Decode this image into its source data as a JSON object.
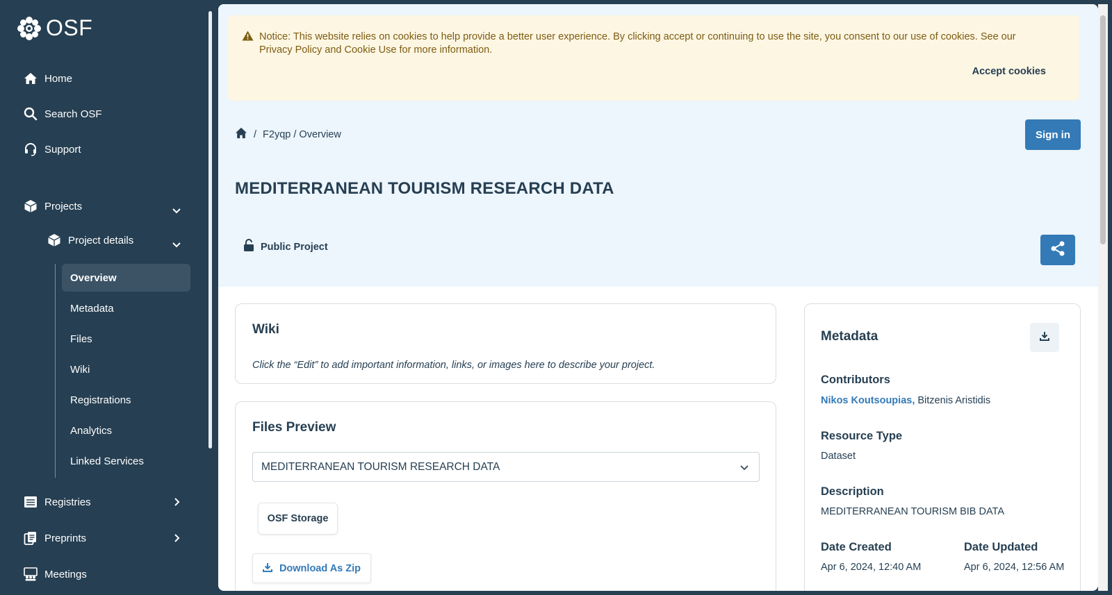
{
  "sidebar": {
    "logo_text": "OSF",
    "nav": [
      {
        "label": "Home",
        "icon": "home-icon"
      },
      {
        "label": "Search OSF",
        "icon": "search-icon"
      },
      {
        "label": "Support",
        "icon": "headset-icon"
      },
      {
        "label": "Projects",
        "icon": "cube-icon"
      },
      {
        "label": "Registries",
        "icon": "registries-icon"
      },
      {
        "label": "Preprints",
        "icon": "preprints-icon"
      },
      {
        "label": "Meetings",
        "icon": "meetings-icon"
      }
    ],
    "project_details": "Project details",
    "sub_items": [
      "Overview",
      "Metadata",
      "Files",
      "Wiki",
      "Registrations",
      "Analytics",
      "Linked Services"
    ]
  },
  "notice": {
    "text": "Notice: This website relies on cookies to help provide a better user experience. By clicking accept or continuing to use the site, you consent to our use of cookies. See our Privacy Policy and Cookie Use for more information.",
    "accept": "Accept cookies"
  },
  "breadcrumb": {
    "separator": "/",
    "path": "F2yqp / Overview"
  },
  "header": {
    "sign_in": "Sign in",
    "title": "MEDITERRANEAN TOURISM RESEARCH DATA",
    "visibility": "Public Project"
  },
  "wiki": {
    "title": "Wiki",
    "text": "Click the “Edit” to add important information, links, or images here to describe your project."
  },
  "files": {
    "title": "Files Preview",
    "selected": "MEDITERRANEAN TOURISM RESEARCH DATA",
    "storage": "OSF Storage",
    "download": "Download As Zip"
  },
  "metadata": {
    "title": "Metadata",
    "contributors_label": "Contributors",
    "contributor_link": "Nikos Koutsoupias,",
    "contributor_other": "Bitzenis Aristidis",
    "resource_type_label": "Resource Type",
    "resource_type": "Dataset",
    "description_label": "Description",
    "description": "MEDITERRANEAN TOURISM BIB DATA",
    "date_created_label": "Date Created",
    "date_created": "Apr 6, 2024, 12:40 AM",
    "date_updated_label": "Date Updated",
    "date_updated": "Apr 6, 2024, 12:56 AM"
  },
  "colors": {
    "sidebar": "#263f52",
    "primary": "#337ab7",
    "hero": "#edf5fd",
    "notice": "#fdf6e3"
  }
}
